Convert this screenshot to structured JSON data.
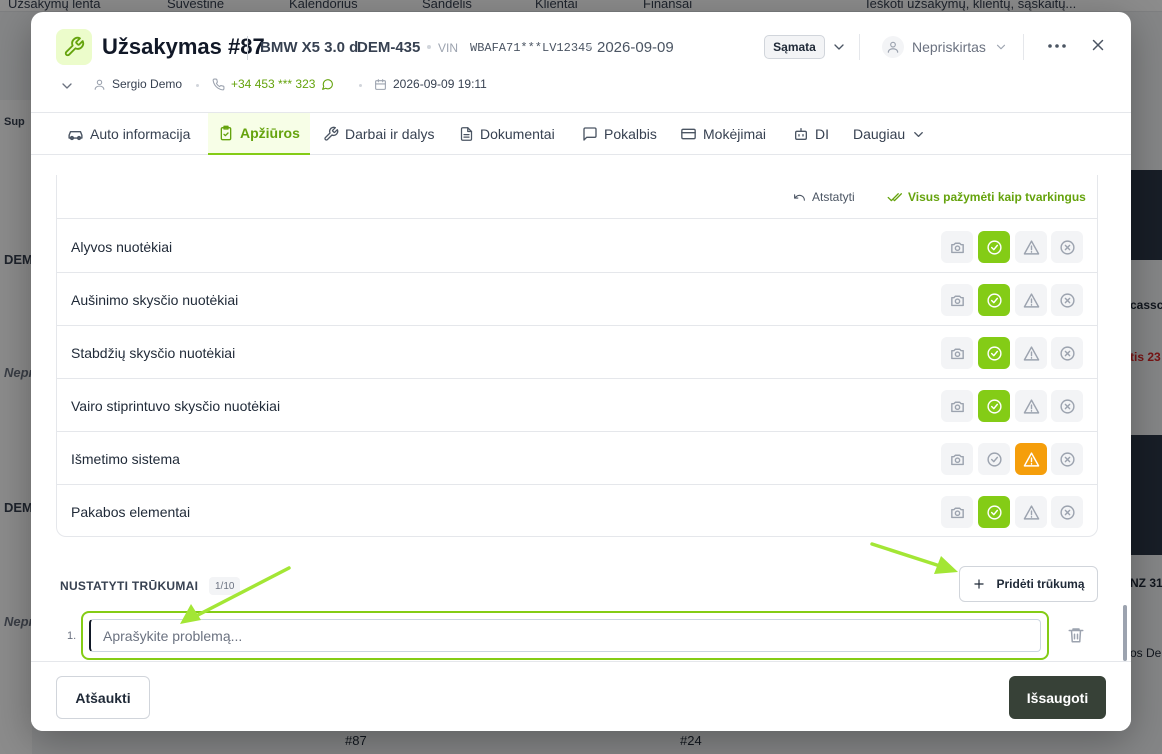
{
  "background": {
    "nav": [
      "Užsakymų lenta",
      "Suvestinė",
      "Kalendorius",
      "Sandėlis",
      "Klientai",
      "Finansai"
    ],
    "search_placeholder": "Ieškoti užsakymų, klientų, sąskaitų...",
    "side_labels": [
      "Sup",
      "DEM",
      "DEM",
      "Nepr",
      "Nepr"
    ],
    "right_texts": [
      "cassc",
      "tis 23",
      "NZ 31",
      "os De"
    ],
    "bottom_tags": [
      "#87",
      "#24"
    ]
  },
  "header": {
    "title": "Užsakymas #87",
    "car_model": "BMW X5 3.0 d",
    "plate": "DEM-435",
    "vin_label": "VIN",
    "vin": "WBAFA71***LV12345",
    "date": "2026-09-09",
    "samata_label": "Sąmata",
    "assignee": "Nepriskirtas",
    "client": "Sergio Demo",
    "phone": "+34 453 *** 323",
    "datetime": "2026-09-09 19:11"
  },
  "tabs": [
    {
      "label": "Auto informacija",
      "icon": "car-icon"
    },
    {
      "label": "Apžiūros",
      "icon": "clipboard-check-icon",
      "active": true
    },
    {
      "label": "Darbai ir dalys",
      "icon": "wrench-icon"
    },
    {
      "label": "Dokumentai",
      "icon": "document-icon"
    },
    {
      "label": "Pokalbis",
      "icon": "chat-icon"
    },
    {
      "label": "Mokėjimai",
      "icon": "card-icon"
    },
    {
      "label": "DI",
      "icon": "robot-icon"
    },
    {
      "label": "Daugiau",
      "icon": "chevron-down-icon"
    }
  ],
  "checklist": {
    "reset_label": "Atstatyti",
    "mark_all_label": "Visus pažymėti kaip tvarkingus",
    "rows": [
      {
        "label": "Alyvos nuotėkiai",
        "status": "ok"
      },
      {
        "label": "Aušinimo skysčio nuotėkiai",
        "status": "ok"
      },
      {
        "label": "Stabdžių skysčio nuotėkiai",
        "status": "ok"
      },
      {
        "label": "Vairo stiprintuvo skysčio nuotėkiai",
        "status": "ok"
      },
      {
        "label": "Išmetimo sistema",
        "status": "warning"
      },
      {
        "label": "Pakabos elementai",
        "status": "ok"
      }
    ]
  },
  "defects": {
    "title": "NUSTATYTI TRŪKUMAI",
    "count": "1/10",
    "add_label": "Pridėti trūkumą",
    "item_number": "1.",
    "input_placeholder": "Aprašykite problemą...",
    "input_value": ""
  },
  "footer": {
    "cancel_label": "Atšaukti",
    "save_label": "Išsaugoti"
  },
  "colors": {
    "accent": "#84cc16",
    "warning": "#f59e0b",
    "save_button": "#374137",
    "annotation_arrow": "#a3e635"
  }
}
